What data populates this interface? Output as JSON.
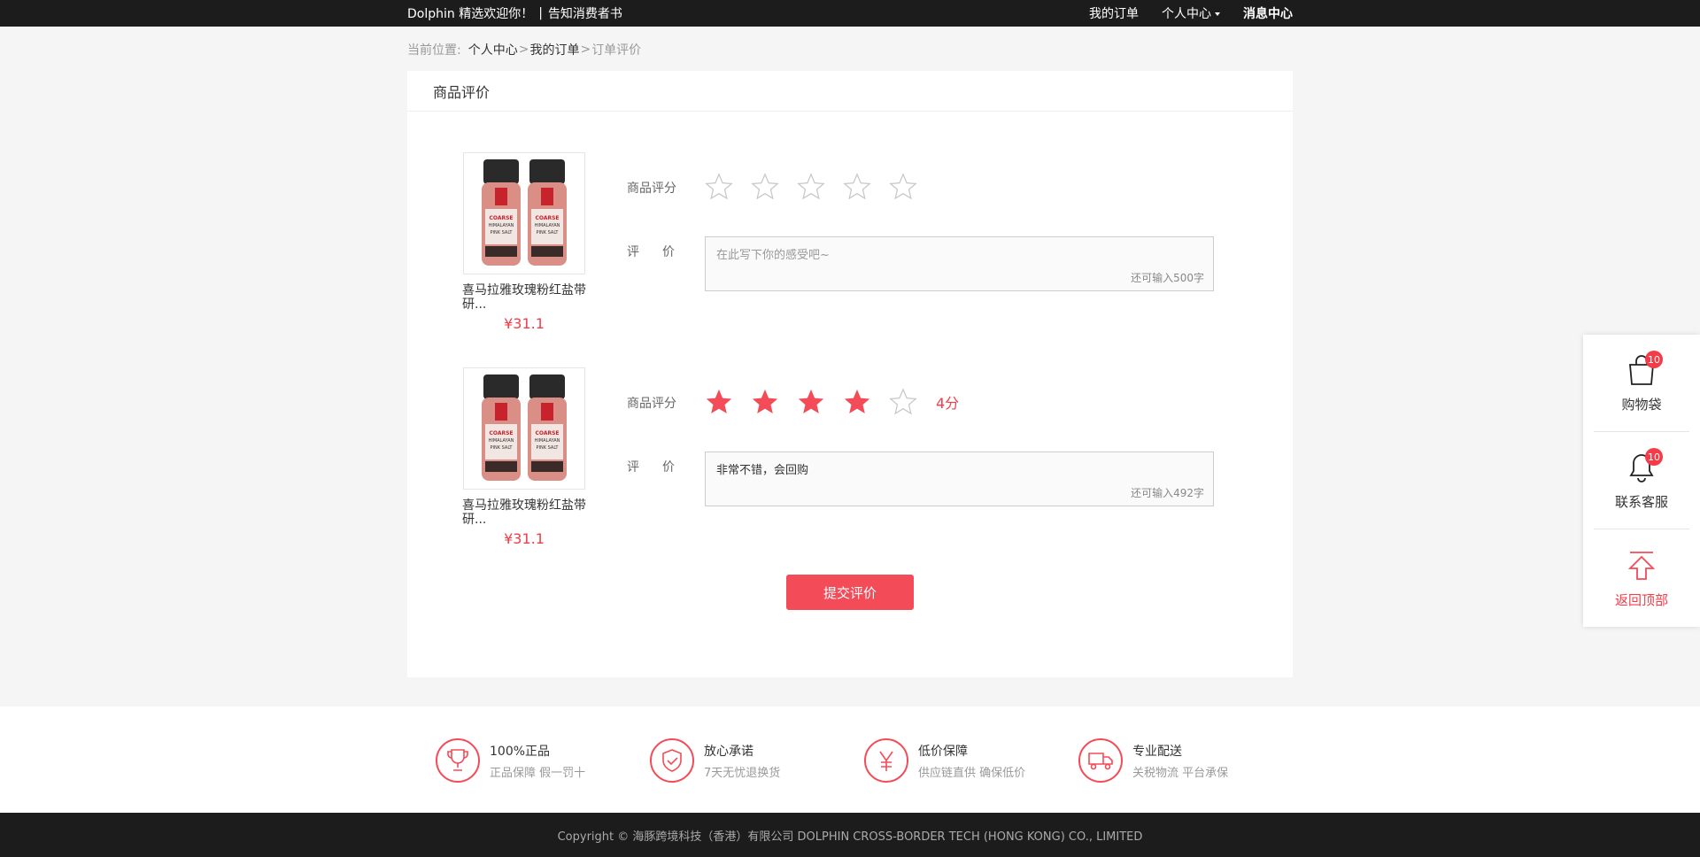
{
  "topbar": {
    "welcome": "Dolphin 精选欢迎你！",
    "separator": "|",
    "notice_link": "告知消费者书",
    "my_orders": "我的订单",
    "personal_center": "个人中心",
    "message_center": "消息中心"
  },
  "breadcrumb": {
    "prefix": "当前位置:",
    "items": [
      "个人中心",
      "我的订单",
      "订单评价"
    ],
    "sep": ">"
  },
  "panel": {
    "title": "商品评价"
  },
  "products": [
    {
      "name": "喜马拉雅玫瑰粉红盐带研...",
      "price": "¥31.1",
      "rating_label": "商品评分",
      "rating": 0,
      "score_text": "",
      "comment_label_a": "评",
      "comment_label_b": "价",
      "comment_text": "",
      "comment_placeholder": "在此写下你的感受吧~",
      "remaining": "还可输入500字",
      "image_text": "COARSE HIMALAYAN PINK SALT"
    },
    {
      "name": "喜马拉雅玫瑰粉红盐带研...",
      "price": "¥31.1",
      "rating_label": "商品评分",
      "rating": 4,
      "score_text": "4分",
      "comment_label_a": "评",
      "comment_label_b": "价",
      "comment_text": "非常不错，会回购",
      "comment_placeholder": "",
      "remaining": "还可输入492字",
      "image_text": "COARSE HIMALAYAN PINK SALT"
    }
  ],
  "submit_label": "提交评价",
  "features": [
    {
      "icon": "trophy-icon",
      "title": "100%正品",
      "sub": "正品保障  假一罚十"
    },
    {
      "icon": "shield-check-icon",
      "title": "放心承诺",
      "sub": "7天无忧退换货"
    },
    {
      "icon": "yen-icon",
      "title": "低价保障",
      "sub": "供应链直供  确保低价"
    },
    {
      "icon": "delivery-truck-icon",
      "title": "专业配送",
      "sub": "关税物流 平台承保"
    }
  ],
  "footer": {
    "copyright": "Copyright ©  海豚跨境科技（香港）有限公司    DOLPHIN CROSS-BORDER TECH (HONG KONG) CO., LIMITED"
  },
  "sidebar": {
    "cart_label": "购物袋",
    "cart_badge": "10",
    "service_label": "联系客服",
    "service_badge": "10",
    "top_label": "返回顶部"
  },
  "colors": {
    "accent": "#f34b57",
    "topbar_bg": "#1c1c1c",
    "page_bg": "#f5f5f5"
  }
}
